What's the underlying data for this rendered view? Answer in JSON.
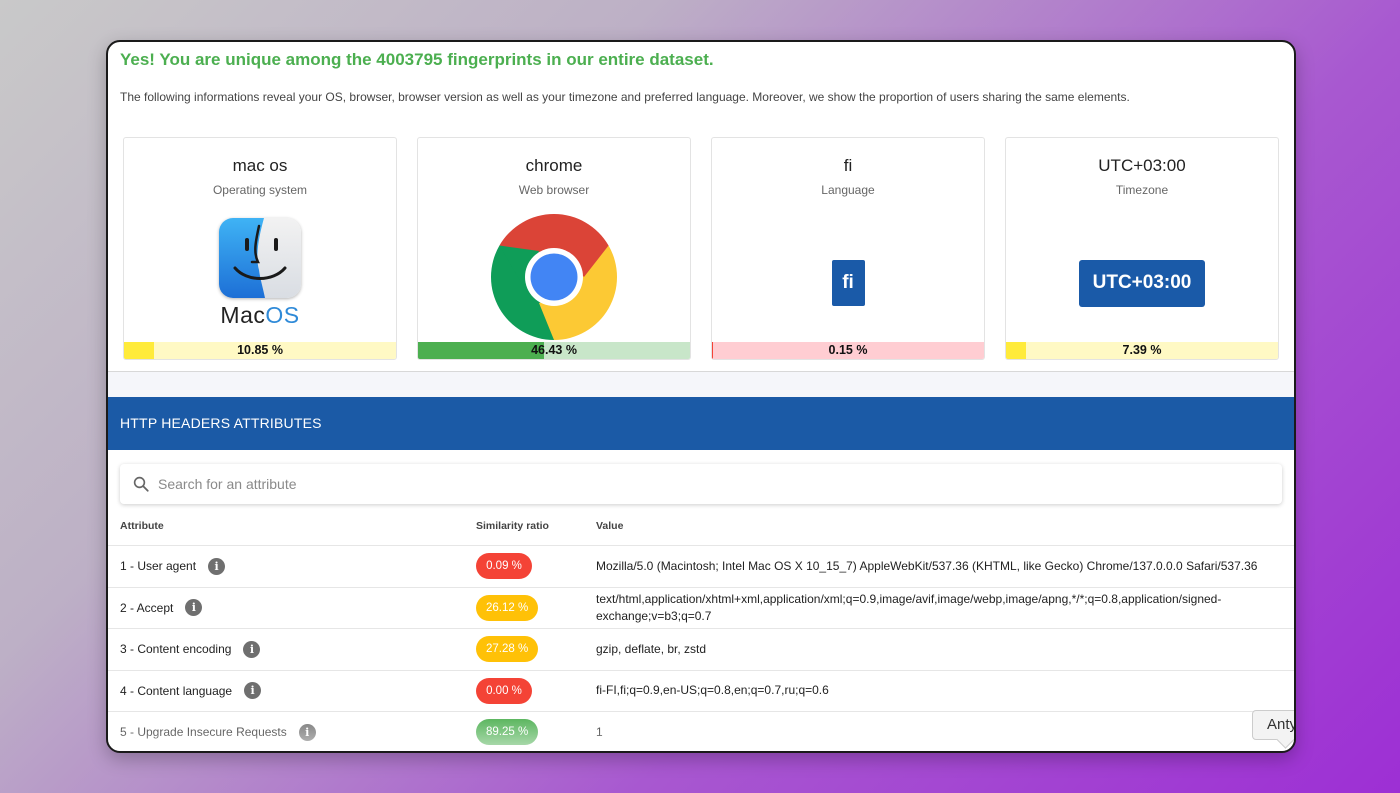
{
  "heading": "Yes! You are unique among the 4003795 fingerprints in our entire dataset.",
  "intro": "The following informations reveal your OS, browser, browser version as well as your timezone and preferred language. Moreover, we show the proportion of users sharing the same elements.",
  "cards": [
    {
      "value": "mac os",
      "label": "Operating system",
      "icon": "macos-finder-icon",
      "logo_text_a": "Mac",
      "logo_text_b": "OS",
      "percent_text": "10.85 %",
      "percent": 10.85,
      "fill_color": "#ffeb3b",
      "track_color": "#fff9c4"
    },
    {
      "value": "chrome",
      "label": "Web browser",
      "icon": "chrome-logo-icon",
      "percent_text": "46.43 %",
      "percent": 46.43,
      "fill_color": "#4caf50",
      "track_color": "#c8e6c9"
    },
    {
      "value": "fi",
      "label": "Language",
      "badge": "fi",
      "percent_text": "0.15 %",
      "percent": 0.15,
      "fill_color": "#f44336",
      "track_color": "#ffcdd2"
    },
    {
      "value": "UTC+03:00",
      "label": "Timezone",
      "badge": "UTC+03:00",
      "percent_text": "7.39 %",
      "percent": 7.39,
      "fill_color": "#ffeb3b",
      "track_color": "#fff9c4"
    }
  ],
  "http_section_title": "HTTP HEADERS ATTRIBUTES",
  "search": {
    "placeholder": "Search for an attribute",
    "value": ""
  },
  "table": {
    "columns": [
      "Attribute",
      "Similarity ratio",
      "Value"
    ],
    "rows": [
      {
        "attribute": "1 - User agent",
        "ratio": "0.09 %",
        "ratio_color": "#f44336",
        "value": "Mozilla/5.0 (Macintosh; Intel Mac OS X 10_15_7) AppleWebKit/537.36 (KHTML, like Gecko) Chrome/137.0.0.0 Safari/537.36"
      },
      {
        "attribute": "2 - Accept",
        "ratio": "26.12 %",
        "ratio_color": "#ffc107",
        "value": "text/html,application/xhtml+xml,application/xml;q=0.9,image/avif,image/webp,image/apng,*/*;q=0.8,application/signed-exchange;v=b3;q=0.7"
      },
      {
        "attribute": "3 - Content encoding",
        "ratio": "27.28 %",
        "ratio_color": "#ffc107",
        "value": "gzip, deflate, br, zstd"
      },
      {
        "attribute": "4 - Content language",
        "ratio": "0.00 %",
        "ratio_color": "#f44336",
        "value": "fi-FI,fi;q=0.9,en-US;q=0.8,en;q=0.7,ru;q=0.6"
      },
      {
        "attribute": "5 - Upgrade Insecure Requests",
        "ratio": "89.25 %",
        "ratio_color": "#4caf50",
        "value": "1"
      }
    ]
  },
  "floating_tooltip": "Antyk"
}
